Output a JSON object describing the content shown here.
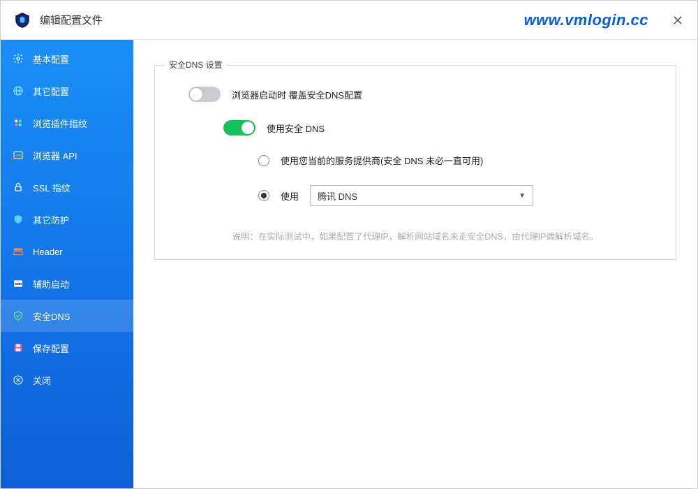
{
  "titlebar": {
    "title": "编辑配置文件",
    "brand": "www.vmlogin.cc"
  },
  "sidebar": {
    "items": [
      {
        "id": "basic",
        "label": "基本配置"
      },
      {
        "id": "other",
        "label": "其它配置"
      },
      {
        "id": "plugins",
        "label": "浏览插件指纹"
      },
      {
        "id": "browserapi",
        "label": "浏览器 API"
      },
      {
        "id": "ssl",
        "label": "SSL 指纹"
      },
      {
        "id": "protect",
        "label": "其它防护"
      },
      {
        "id": "header",
        "label": "Header"
      },
      {
        "id": "auxstart",
        "label": "辅助启动"
      },
      {
        "id": "securedns",
        "label": "安全DNS"
      },
      {
        "id": "save",
        "label": "保存配置"
      },
      {
        "id": "close",
        "label": "关闭"
      }
    ]
  },
  "panel": {
    "groupTitle": "安全DNS 设置",
    "overrideLabel": "浏览器启动时 覆盖安全DNS配置",
    "useSecureDnsLabel": "使用安全 DNS",
    "option1": "使用您当前的服务提供商(安全 DNS 未必一直可用)",
    "option2Prefix": "使用",
    "providerSelected": "腾讯 DNS",
    "note": "说明：在实际测试中，如果配置了代理IP，解析网站域名未走安全DNS，由代理IP端解析域名。"
  }
}
